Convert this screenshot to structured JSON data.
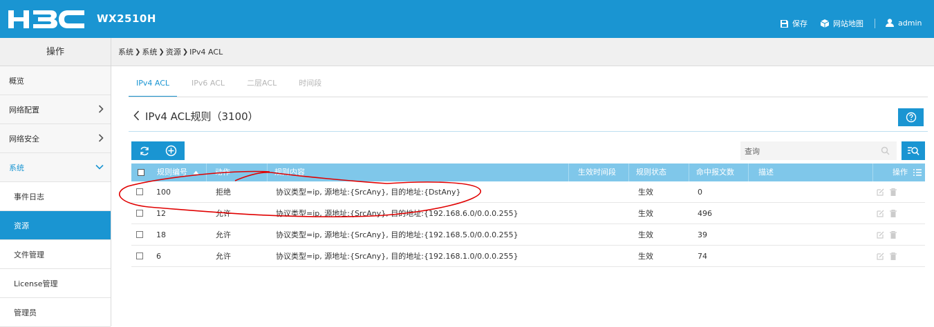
{
  "header": {
    "model": "WX2510H",
    "save_label": "保存",
    "sitemap_label": "网站地图",
    "user_label": "admin"
  },
  "sidebar": {
    "title": "操作",
    "items": [
      {
        "label": "概览"
      },
      {
        "label": "网络配置"
      },
      {
        "label": "网络安全"
      },
      {
        "label": "系统"
      }
    ],
    "sub_items": [
      {
        "label": "事件日志"
      },
      {
        "label": "资源"
      },
      {
        "label": "文件管理"
      },
      {
        "label": "License管理"
      },
      {
        "label": "管理员"
      }
    ]
  },
  "breadcrumb": [
    "系统",
    "系统",
    "资源",
    "IPv4 ACL"
  ],
  "tabs": [
    {
      "label": "IPv4 ACL"
    },
    {
      "label": "IPv6 ACL"
    },
    {
      "label": "二层ACL"
    },
    {
      "label": "时间段"
    }
  ],
  "page": {
    "title": "IPv4 ACL规则（3100）"
  },
  "search": {
    "placeholder": "查询"
  },
  "table": {
    "headers": {
      "rule_id": "规则编号",
      "action": "动作",
      "content": "规则内容",
      "time_range": "生效时间段",
      "status": "规则状态",
      "hits": "命中报文数",
      "desc": "描述",
      "ops": "操作"
    },
    "rows": [
      {
        "rule_id": "100",
        "action": "拒绝",
        "content": "协议类型=ip, 源地址:{SrcAny}, 目的地址:{DstAny}",
        "status": "生效",
        "hits": "0"
      },
      {
        "rule_id": "12",
        "action": "允许",
        "content": "协议类型=ip, 源地址:{SrcAny}, 目的地址:{192.168.6.0/0.0.0.255}",
        "status": "生效",
        "hits": "496"
      },
      {
        "rule_id": "18",
        "action": "允许",
        "content": "协议类型=ip, 源地址:{SrcAny}, 目的地址:{192.168.5.0/0.0.0.255}",
        "status": "生效",
        "hits": "39"
      },
      {
        "rule_id": "6",
        "action": "允许",
        "content": "协议类型=ip, 源地址:{SrcAny}, 目的地址:{192.168.1.0/0.0.0.255}",
        "status": "生效",
        "hits": "74"
      }
    ]
  },
  "colors": {
    "brand": "#1a95d2",
    "table_header": "#7fc7ea",
    "annotation": "#e00000"
  }
}
